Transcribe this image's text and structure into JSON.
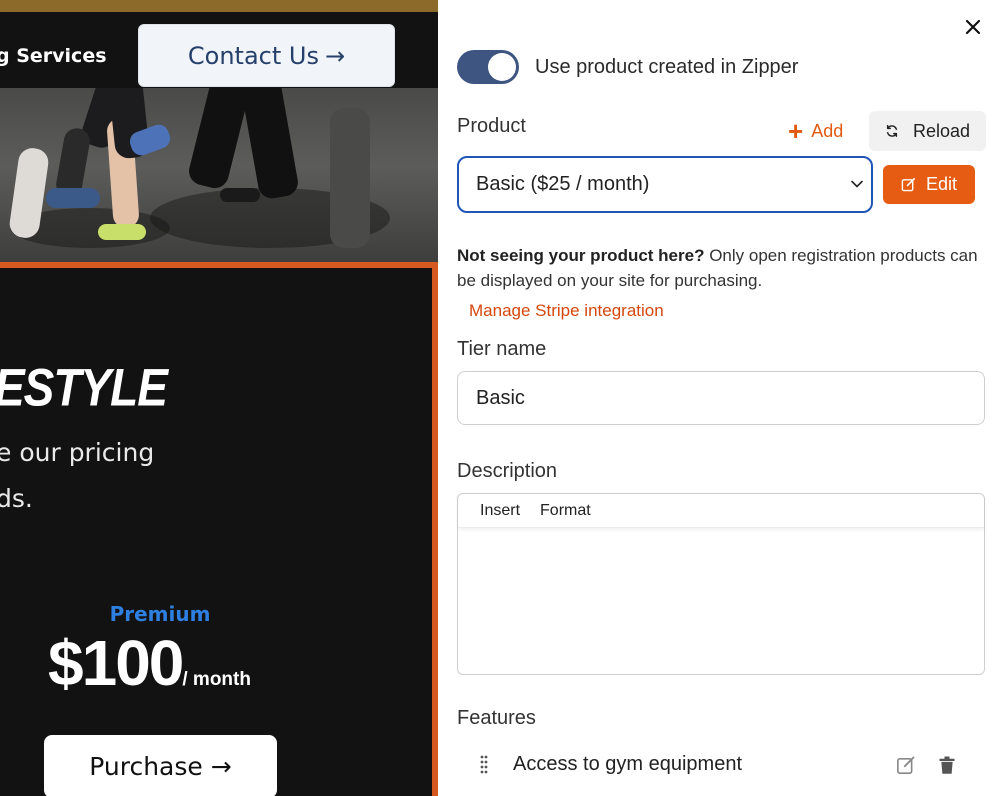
{
  "preview": {
    "nav_link": "g Services",
    "contact_button": "Contact Us",
    "arrow": "→",
    "heading": "ESTYLE",
    "paragraph_line_1": "e our pricing",
    "paragraph_line_2": "ds.",
    "tier_label": "Premium",
    "price_amount": "$100",
    "price_period": "/ month",
    "purchase_button": "Purchase",
    "accent_color": "#d65a1f"
  },
  "panel": {
    "toggle": {
      "label": "Use product created in Zipper",
      "on": true
    },
    "product": {
      "label": "Product",
      "add_label": "Add",
      "reload_label": "Reload",
      "selected": "Basic ($25 / month)",
      "edit_label": "Edit"
    },
    "help": {
      "bold": "Not seeing your product here?",
      "rest": " Only open registration products can be displayed on your site for purchasing."
    },
    "stripe_link": "Manage Stripe integration",
    "tier_name": {
      "label": "Tier name",
      "value": "Basic"
    },
    "description": {
      "label": "Description",
      "menu_insert": "Insert",
      "menu_format": "Format"
    },
    "features": {
      "label": "Features",
      "items": [
        {
          "text": "Access to gym equipment"
        }
      ]
    },
    "colors": {
      "accent": "#e65c12",
      "select_border": "#1f56b8",
      "toggle": "#3d5580"
    }
  }
}
